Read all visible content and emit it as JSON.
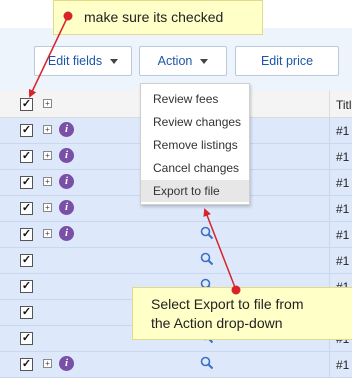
{
  "callout_top": "make sure its checked",
  "callout_bottom": {
    "line1": "Select Export to file from",
    "line2": "the Action drop-down"
  },
  "toolbar": {
    "edit_fields": "Edit fields",
    "action": "Action",
    "edit_price": "Edit price"
  },
  "table": {
    "header_title": "Titl",
    "select_all_checked": true,
    "rows": [
      {
        "checked": true,
        "info": true,
        "search": false,
        "title": "#1"
      },
      {
        "checked": true,
        "info": true,
        "search": false,
        "title": "#1"
      },
      {
        "checked": true,
        "info": true,
        "search": false,
        "title": "#1"
      },
      {
        "checked": true,
        "info": true,
        "search": false,
        "title": "#1"
      },
      {
        "checked": true,
        "info": true,
        "search": true,
        "title": "#1"
      },
      {
        "checked": true,
        "info": false,
        "search": true,
        "title": "#1"
      },
      {
        "checked": true,
        "info": false,
        "search": true,
        "title": "#1"
      },
      {
        "checked": true,
        "info": false,
        "search": true,
        "title": "#1"
      },
      {
        "checked": true,
        "info": false,
        "search": true,
        "title": "#1"
      },
      {
        "checked": true,
        "info": true,
        "search": true,
        "title": "#1"
      }
    ]
  },
  "action_menu": {
    "items": [
      "Review fees",
      "Review changes",
      "Remove listings",
      "Cancel changes",
      "Export to file"
    ],
    "highlighted": "Export to file"
  },
  "colors": {
    "row_selected": "#dde9fb",
    "link_blue": "#1a57a8",
    "info_purple": "#7a4fa6",
    "callout_yellow": "#ffffc8",
    "annotation_red": "#d9232b"
  },
  "icons": [
    "checkbox-checked-icon",
    "expand-plus-icon",
    "info-icon",
    "search-icon",
    "caret-down-icon"
  ]
}
